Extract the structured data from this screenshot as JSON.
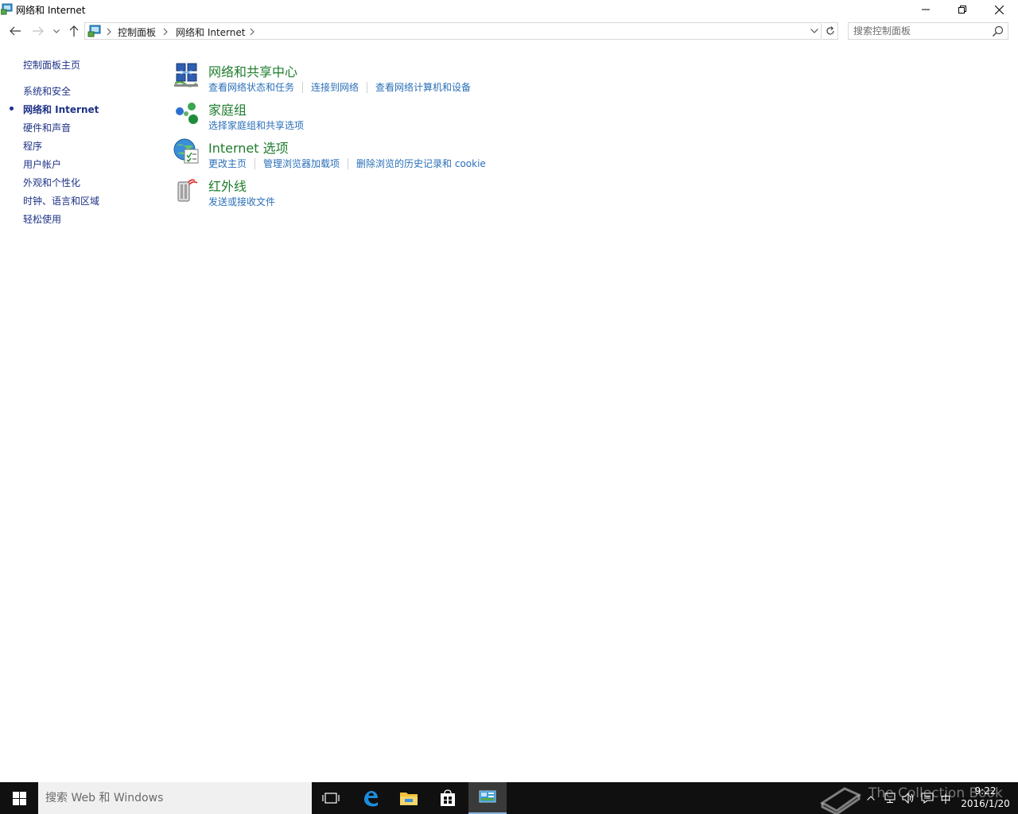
{
  "window": {
    "title": "网络和 Internet",
    "icon": "control-panel-icon"
  },
  "navigation": {
    "breadcrumbs": [
      "控制面板",
      "网络和 Internet"
    ],
    "search_placeholder": "搜索控制面板"
  },
  "sidebar": {
    "items": [
      {
        "label": "控制面板主页",
        "active": false
      },
      {
        "label": "系统和安全",
        "active": false
      },
      {
        "label": "网络和 Internet",
        "active": true
      },
      {
        "label": "硬件和声音",
        "active": false
      },
      {
        "label": "程序",
        "active": false
      },
      {
        "label": "用户帐户",
        "active": false
      },
      {
        "label": "外观和个性化",
        "active": false
      },
      {
        "label": "时钟、语言和区域",
        "active": false
      },
      {
        "label": "轻松使用",
        "active": false
      }
    ]
  },
  "categories": [
    {
      "title": "网络和共享中心",
      "icon": "network-sharing-center-icon",
      "links": [
        "查看网络状态和任务",
        "连接到网络",
        "查看网络计算机和设备"
      ]
    },
    {
      "title": "家庭组",
      "icon": "homegroup-icon",
      "links": [
        "选择家庭组和共享选项"
      ]
    },
    {
      "title": "Internet 选项",
      "icon": "internet-options-icon",
      "links": [
        "更改主页",
        "管理浏览器加载项",
        "删除浏览的历史记录和 cookie"
      ]
    },
    {
      "title": "红外线",
      "icon": "infrared-icon",
      "links": [
        "发送或接收文件"
      ]
    }
  ],
  "taskbar": {
    "search_placeholder": "搜索 Web 和 Windows",
    "apps": [
      "task-view-icon",
      "edge-icon",
      "file-explorer-icon",
      "store-icon",
      "control-panel-icon"
    ],
    "tray_ime": "中",
    "time": "9:22",
    "date": "2016/1/20",
    "watermark": "The Collection Book"
  },
  "colors": {
    "category_title": "#1e7d2d",
    "link": "#2a6fb8",
    "sidebar_link": "#1e3287",
    "taskbar": "#101010"
  }
}
